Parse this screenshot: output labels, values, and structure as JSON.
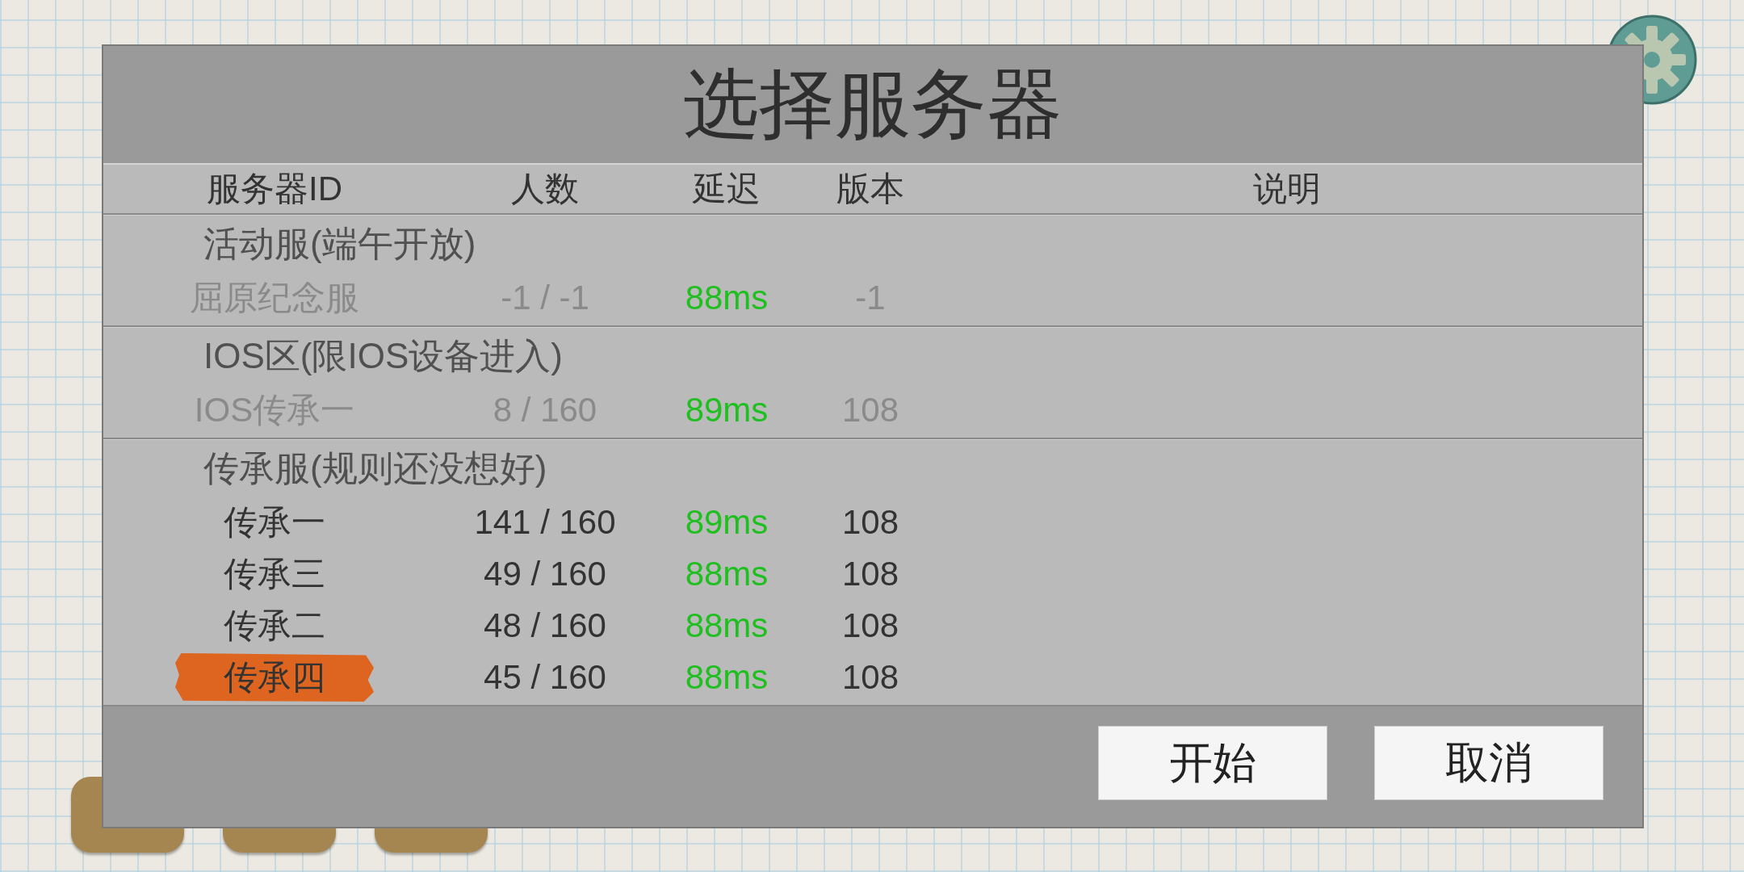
{
  "dialog": {
    "title": "选择服务器",
    "columns": [
      "服务器ID",
      "人数",
      "延迟",
      "版本",
      "说明"
    ],
    "groups": [
      {
        "name": "活动服(端午开放)",
        "servers": [
          {
            "name": "屈原纪念服",
            "players": "-1 / -1",
            "latency": "88ms",
            "version": "-1",
            "disabled": true,
            "selected": false
          }
        ]
      },
      {
        "name": "IOS区(限IOS设备进入)",
        "servers": [
          {
            "name": "IOS传承一",
            "players": "8 / 160",
            "latency": "89ms",
            "version": "108",
            "disabled": true,
            "selected": false
          }
        ]
      },
      {
        "name": "传承服(规则还没想好)",
        "servers": [
          {
            "name": "传承一",
            "players": "141 / 160",
            "latency": "89ms",
            "version": "108",
            "disabled": false,
            "selected": false
          },
          {
            "name": "传承三",
            "players": "49 / 160",
            "latency": "88ms",
            "version": "108",
            "disabled": false,
            "selected": false
          },
          {
            "name": "传承二",
            "players": "48 / 160",
            "latency": "88ms",
            "version": "108",
            "disabled": false,
            "selected": false
          },
          {
            "name": "传承四",
            "players": "45 / 160",
            "latency": "88ms",
            "version": "108",
            "disabled": false,
            "selected": true
          }
        ]
      }
    ],
    "buttons": [
      "开始",
      "取消"
    ]
  }
}
